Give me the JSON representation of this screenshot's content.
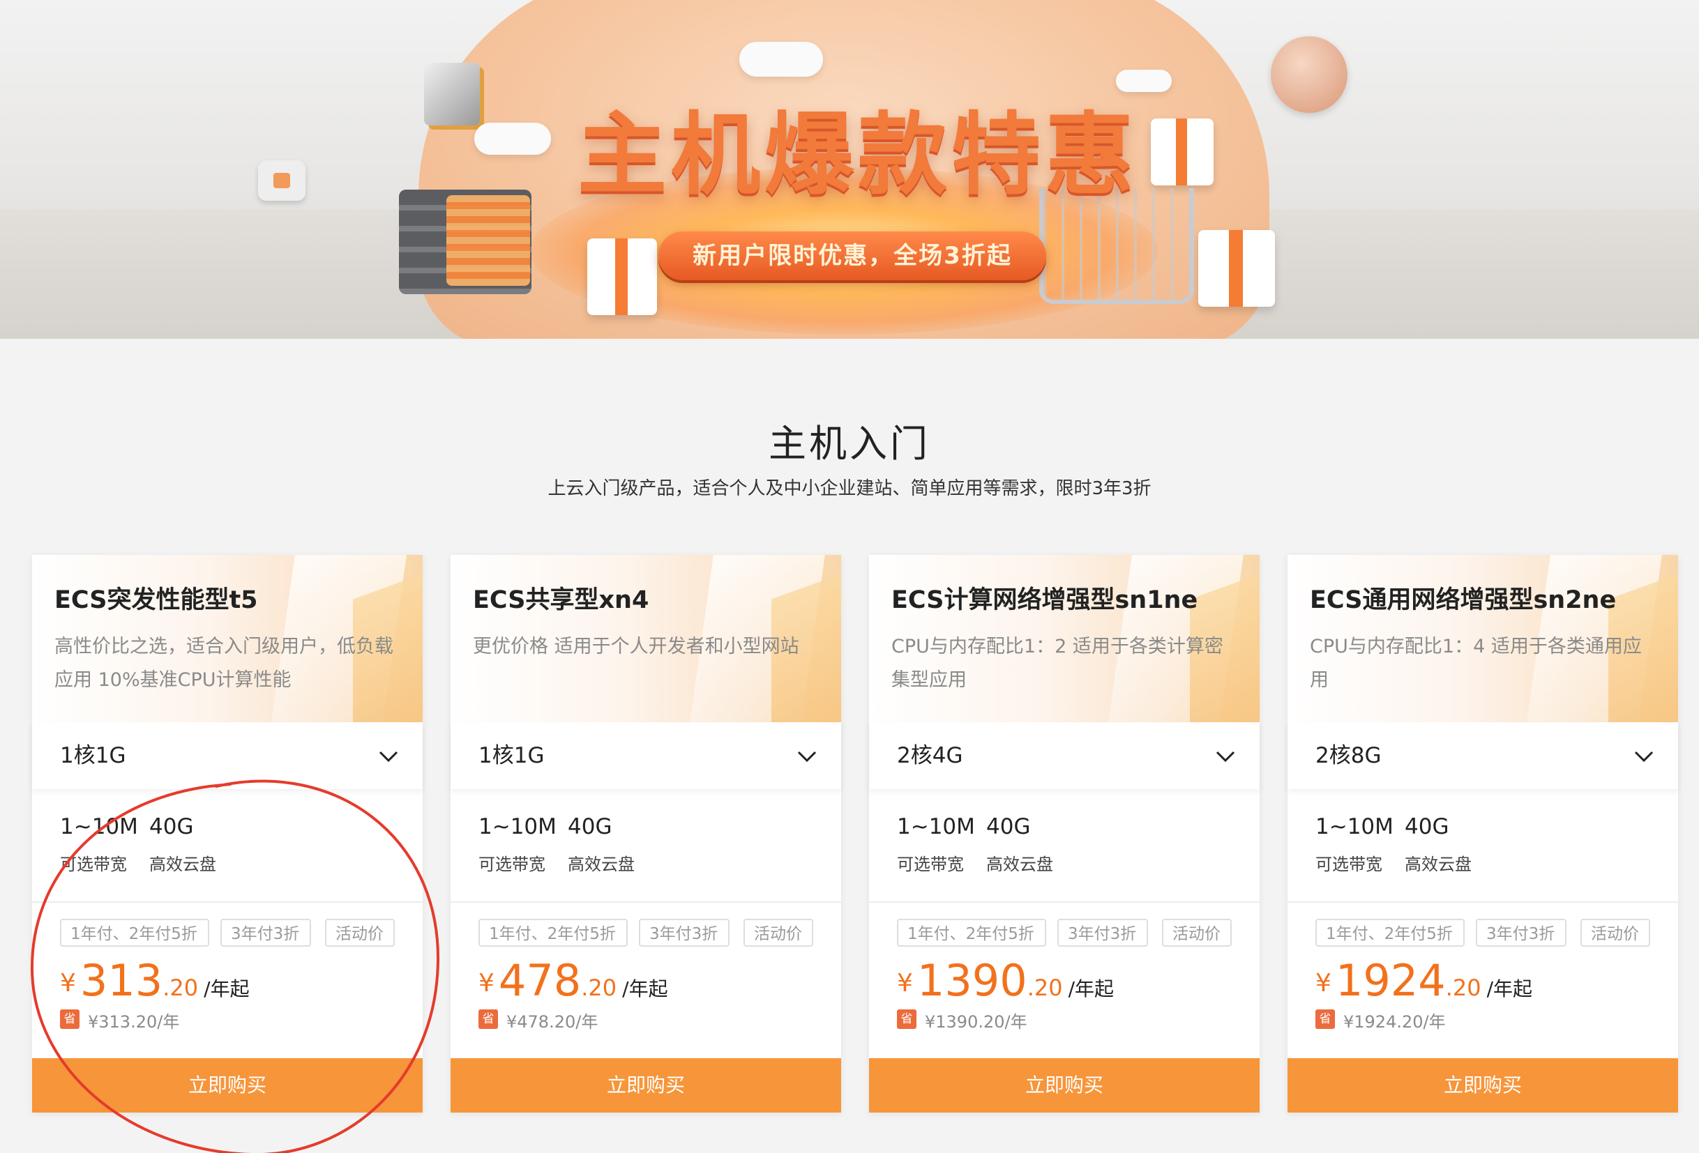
{
  "banner": {
    "title": "主机爆款特惠",
    "subtitle": "新用户限时优惠，全场3折起"
  },
  "section": {
    "title": "主机入门",
    "subtitle": "上云入门级产品，适合个人及中小企业建站、简单应用等需求，限时3年3折"
  },
  "colors": {
    "accent": "#f2711c",
    "button": "#f7953a",
    "annotation": "#e53b2c"
  },
  "icons": {
    "dropdown": "chevron-down-icon",
    "save": "save-badge"
  },
  "cards": [
    {
      "title": "ECS突发性能型t5",
      "desc": "高性价比之选，适合入门级用户，低负载应用 10%基准CPU计算性能",
      "config": "1核1G",
      "bandwidth": "1~10M",
      "bandwidth_label": "可选带宽",
      "disk": "40G",
      "disk_label": "高效云盘",
      "tags": [
        "1年付、2年付5折",
        "3年付3折",
        "活动价"
      ],
      "currency": "¥",
      "price_int": "313",
      "price_dec": ".20",
      "price_unit": "/年起",
      "save_badge": "省",
      "save_text": "¥313.20/年",
      "buy_label": "立即购买"
    },
    {
      "title": "ECS共享型xn4",
      "desc": "更优价格 适用于个人开发者和小型网站",
      "config": "1核1G",
      "bandwidth": "1~10M",
      "bandwidth_label": "可选带宽",
      "disk": "40G",
      "disk_label": "高效云盘",
      "tags": [
        "1年付、2年付5折",
        "3年付3折",
        "活动价"
      ],
      "currency": "¥",
      "price_int": "478",
      "price_dec": ".20",
      "price_unit": "/年起",
      "save_badge": "省",
      "save_text": "¥478.20/年",
      "buy_label": "立即购买"
    },
    {
      "title": "ECS计算网络增强型sn1ne",
      "desc": "CPU与内存配比1：2 适用于各类计算密集型应用",
      "config": "2核4G",
      "bandwidth": "1~10M",
      "bandwidth_label": "可选带宽",
      "disk": "40G",
      "disk_label": "高效云盘",
      "tags": [
        "1年付、2年付5折",
        "3年付3折",
        "活动价"
      ],
      "currency": "¥",
      "price_int": "1390",
      "price_dec": ".20",
      "price_unit": "/年起",
      "save_badge": "省",
      "save_text": "¥1390.20/年",
      "buy_label": "立即购买"
    },
    {
      "title": "ECS通用网络增强型sn2ne",
      "desc": "CPU与内存配比1：4 适用于各类通用应用",
      "config": "2核8G",
      "bandwidth": "1~10M",
      "bandwidth_label": "可选带宽",
      "disk": "40G",
      "disk_label": "高效云盘",
      "tags": [
        "1年付、2年付5折",
        "3年付3折",
        "活动价"
      ],
      "currency": "¥",
      "price_int": "1924",
      "price_dec": ".20",
      "price_unit": "/年起",
      "save_badge": "省",
      "save_text": "¥1924.20/年",
      "buy_label": "立即购买"
    }
  ]
}
